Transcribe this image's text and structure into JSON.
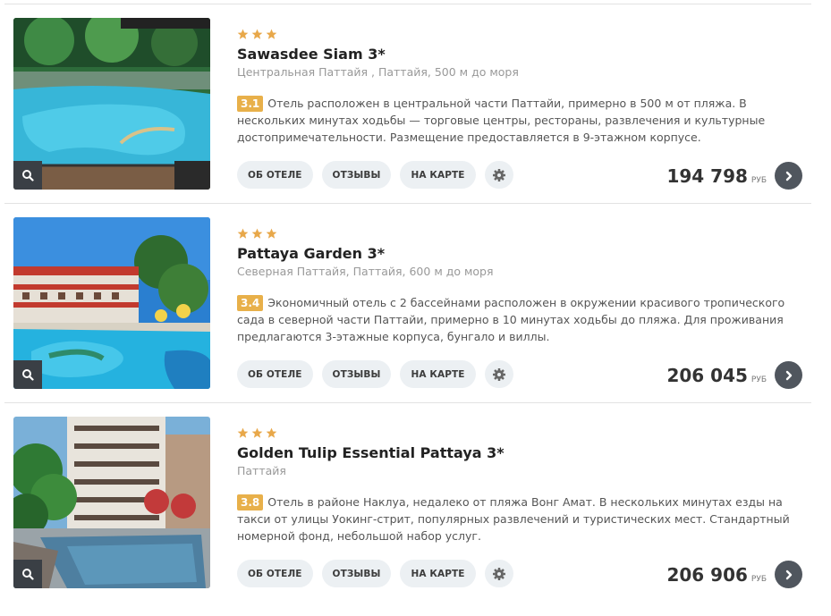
{
  "hotels": [
    {
      "stars": 3,
      "name": "Sawasdee Siam 3*",
      "location": "Центральная Паттайя , Паттайя, 500 м до моря",
      "rating": "3.1",
      "description": "Отель расположен в центральной части Паттайи, примерно в 500 м от пляжа. В нескольких минутах ходьбы — торговые центры, рестораны, развлечения и культурные достопримечательности. Размещение предоставляется в 9-этажном корпусе.",
      "price": "194 798",
      "currency": "РУБ"
    },
    {
      "stars": 3,
      "name": "Pattaya Garden 3*",
      "location": "Северная Паттайя, Паттайя, 600 м до моря",
      "rating": "3.4",
      "description": "Экономичный отель с 2 бассейнами расположен в окружении красивого тропического сада в северной части Паттайи, примерно в 10 минутах ходьбы до пляжа. Для проживания предлагаются 3-этажные корпуса, бунгало и виллы.",
      "price": "206 045",
      "currency": "РУБ"
    },
    {
      "stars": 3,
      "name": "Golden Tulip Essential Pattaya 3*",
      "location": "Паттайя",
      "rating": "3.8",
      "description": "Отель в районе Наклуа, недалеко от пляжа Вонг Амат. В нескольких минутах езды на такси от улицы Уокинг-стрит, популярных развлечений и туристических мест. Стандартный номерной фонд, небольшой набор услуг.",
      "price": "206 906",
      "currency": "РУБ"
    }
  ],
  "buttons": {
    "about": "ОБ ОТЕЛЕ",
    "reviews": "ОТЗЫВЫ",
    "map": "НА КАРТЕ"
  },
  "colors": {
    "star": "#e8a84a",
    "rating_badge": "#e8b04a",
    "button_bg": "#ecf0f3",
    "arrow_bg": "#50565e"
  },
  "icons": [
    "star-icon",
    "zoom-icon",
    "gear-icon",
    "chevron-right-icon"
  ]
}
